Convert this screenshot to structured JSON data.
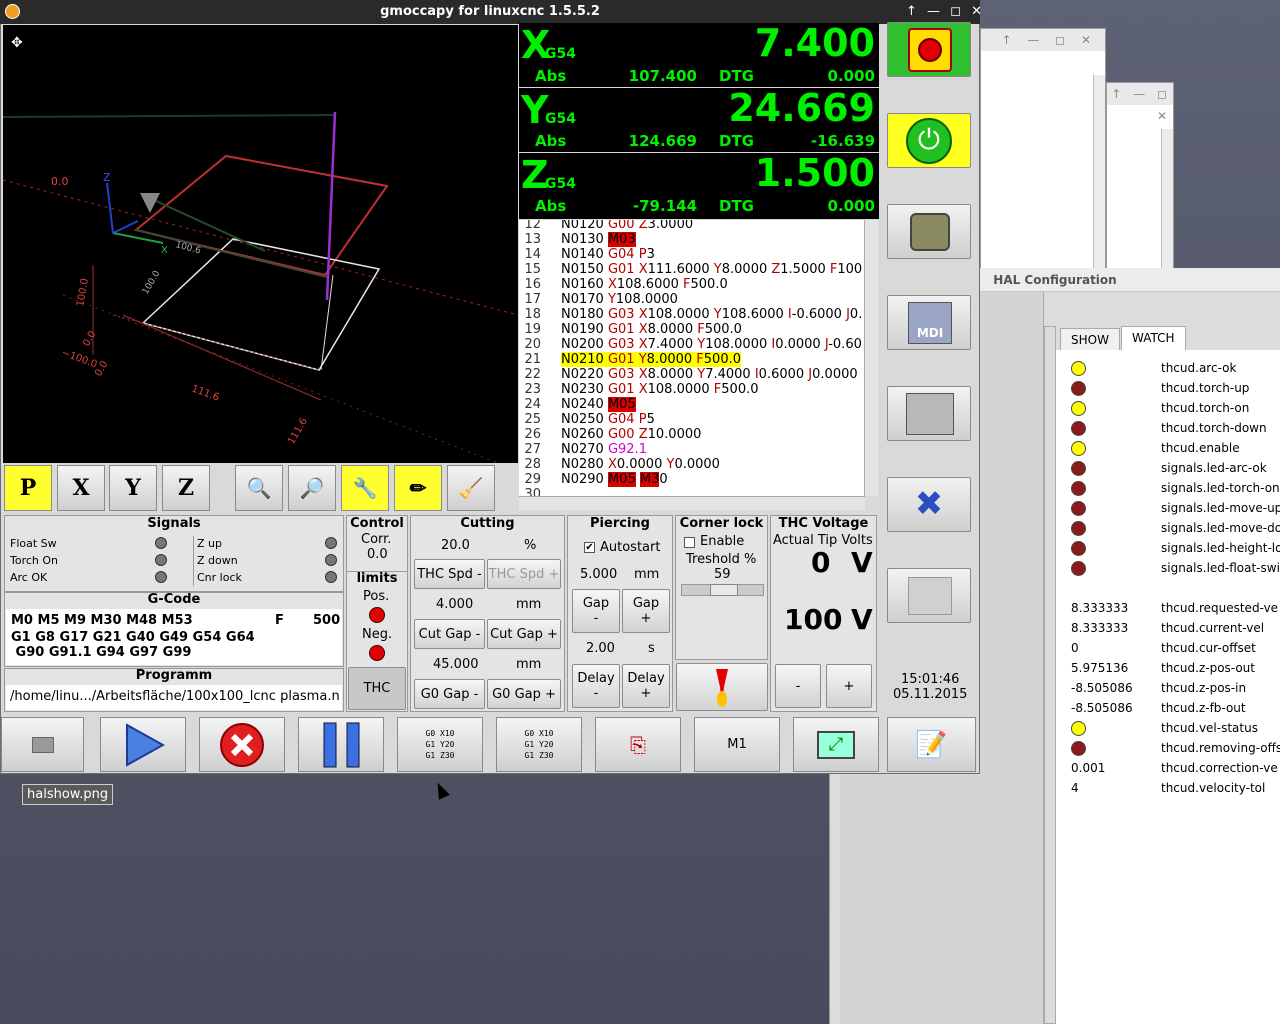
{
  "window": {
    "title": "gmoccapy for linuxcnc  1.5.5.2",
    "controls": "↑ — ◻ ✕"
  },
  "bg_window": {
    "controls": "↑ — ◻ ✕"
  },
  "hal": {
    "title": "HAL Configuration",
    "tabs": [
      "SHOW",
      "WATCH"
    ],
    "rows": [
      {
        "state": "y",
        "name": "thcud.arc-ok"
      },
      {
        "state": "r",
        "name": "thcud.torch-up"
      },
      {
        "state": "y",
        "name": "thcud.torch-on"
      },
      {
        "state": "r",
        "name": "thcud.torch-down"
      },
      {
        "state": "y",
        "name": "thcud.enable"
      },
      {
        "state": "r",
        "name": "signals.led-arc-ok"
      },
      {
        "state": "r",
        "name": "signals.led-torch-on"
      },
      {
        "state": "r",
        "name": "signals.led-move-up"
      },
      {
        "state": "r",
        "name": "signals.led-move-do"
      },
      {
        "state": "r",
        "name": "signals.led-height-lo"
      },
      {
        "state": "r",
        "name": "signals.led-float-swit"
      },
      {
        "state": "",
        "name": ""
      },
      {
        "value": "8.333333",
        "name": "thcud.requested-ve"
      },
      {
        "value": "8.333333",
        "name": "thcud.current-vel"
      },
      {
        "value": "0",
        "name": "thcud.cur-offset"
      },
      {
        "value": "5.975136",
        "name": "thcud.z-pos-out"
      },
      {
        "value": "-8.505086",
        "name": "thcud.z-pos-in"
      },
      {
        "value": "-8.505086",
        "name": "thcud.z-fb-out"
      },
      {
        "state": "y",
        "name": "thcud.vel-status"
      },
      {
        "state": "r",
        "name": "thcud.removing-offs"
      },
      {
        "value": "0.001",
        "name": "thcud.correction-ve"
      },
      {
        "value": "4",
        "name": "thcud.velocity-tol"
      }
    ]
  },
  "preview": {
    "labels": {
      "z": "Z",
      "x": "X",
      "zero": "0.0",
      "v100": "100.0",
      "neg100": "−100.0",
      "v1116a": "111.6",
      "v1116b": "111.6",
      "v00a": "0.0",
      "v00b": "0.0",
      "v100b": "100.0",
      "v1006": "100.6"
    }
  },
  "dro": [
    {
      "axis": "X",
      "coord": "G54",
      "value": "7.400",
      "abs_label": "Abs",
      "abs": "107.400",
      "dtg_label": "DTG",
      "dtg": "0.000"
    },
    {
      "axis": "Y",
      "coord": "G54",
      "value": "24.669",
      "abs_label": "Abs",
      "abs": "124.669",
      "dtg_label": "DTG",
      "dtg": "-16.639"
    },
    {
      "axis": "Z",
      "coord": "G54",
      "value": "1.500",
      "abs_label": "Abs",
      "abs": "-79.144",
      "dtg_label": "DTG",
      "dtg": "0.000"
    }
  ],
  "gcode_lines": [
    {
      "n": "12",
      "html": "N0120 <span class='kw'>G00</span> <span class='kw'>Z</span>3.0000"
    },
    {
      "n": "13",
      "html": "N0130 <span class='redb'>M03</span>"
    },
    {
      "n": "14",
      "html": "N0140 <span class='kw'>G04</span> <span class='kw'>P</span>3"
    },
    {
      "n": "15",
      "html": "N0150 <span class='kw'>G01</span> <span class='kw'>X</span>111.6000 <span class='kw'>Y</span>8.0000 <span class='kw'>Z</span>1.5000 <span class='kw'>F</span>100"
    },
    {
      "n": "16",
      "html": "N0160 <span class='kw'>X</span>108.6000 <span class='kw'>F</span>500.0"
    },
    {
      "n": "17",
      "html": "N0170 <span class='kw'>Y</span>108.0000"
    },
    {
      "n": "18",
      "html": "N0180 <span class='kw'>G03</span> <span class='kw'>X</span>108.0000 <span class='kw'>Y</span>108.6000 <span class='kw'>I</span>-0.6000 <span class='kw'>J</span>0."
    },
    {
      "n": "19",
      "html": "N0190 <span class='kw'>G01</span> <span class='kw'>X</span>8.0000 <span class='kw'>F</span>500.0"
    },
    {
      "n": "20",
      "html": "N0200 <span class='kw'>G03</span> <span class='kw'>X</span>7.4000 <span class='kw'>Y</span>108.0000 <span class='kw'>I</span>0.0000 <span class='kw'>J</span>-0.60"
    },
    {
      "n": "21",
      "html": "N0210 <span class='kw'>G01</span> <span class='kw'>Y</span>8.0000 <span class='kw'>F</span>500.0",
      "hl": true
    },
    {
      "n": "22",
      "html": "N0220 <span class='kw'>G03</span> <span class='kw'>X</span>8.0000 <span class='kw'>Y</span>7.4000 <span class='kw'>I</span>0.6000 <span class='kw'>J</span>0.0000"
    },
    {
      "n": "23",
      "html": "N0230 <span class='kw'>G01</span> <span class='kw'>X</span>108.0000 <span class='kw'>F</span>500.0"
    },
    {
      "n": "24",
      "html": "N0240 <span class='redb'>M05</span>"
    },
    {
      "n": "25",
      "html": "N0250 <span class='kw'>G04</span> <span class='kw'>P</span>5"
    },
    {
      "n": "26",
      "html": "N0260 <span class='kw'>G00</span> <span class='kw'>Z</span>10.0000"
    },
    {
      "n": "27",
      "html": "N0270 <span class='mag'>G92.1</span>"
    },
    {
      "n": "28",
      "html": "N0280 <span class='kw'>X</span>0.0000 <span class='kw'>Y</span>0.0000"
    },
    {
      "n": "29",
      "html": "N0290 <span class='redb'>M05</span> <span class='redb'>M3</span>0"
    },
    {
      "n": "30",
      "html": ""
    }
  ],
  "signals": {
    "title": "Signals",
    "left": [
      "Float Sw",
      "Torch On",
      "Arc OK"
    ],
    "right": [
      "Z up",
      "Z down",
      "Cnr lock"
    ]
  },
  "gcode": {
    "title": "G-Code",
    "line1": "M0 M5 M9 M30 M48 M53",
    "f_label": "F",
    "f_value": "500",
    "line2": "G1 G8 G17 G21 G40 G49 G54 G64",
    "line3": " G90 G91.1 G94 G97 G99"
  },
  "programm": {
    "title": "Programm",
    "path": "/home/linu.../Arbeitsfläche/100x100_lcnc plasma.n"
  },
  "control": {
    "title": "Control",
    "corr_label": "Corr.",
    "corr": "0.0",
    "limits": "limits",
    "pos": "Pos.",
    "neg": "Neg.",
    "thc": "THC"
  },
  "cutting": {
    "title": "Cutting",
    "v1": "20.0",
    "u1": "%",
    "b1": "THC Spd -",
    "b2": "THC Spd +",
    "v2": "4.000",
    "u2": "mm",
    "b3": "Cut Gap -",
    "b4": "Cut Gap +",
    "v3": "45.000",
    "u3": "mm",
    "b5": "G0 Gap -",
    "b6": "G0 Gap +"
  },
  "piercing": {
    "title": "Piercing",
    "autostart": "Autostart",
    "v1": "5.000",
    "u1": "mm",
    "gap_minus": "Gap\n-",
    "gap_plus": "Gap\n+",
    "v2": "2.00",
    "u2": "s",
    "delay_minus": "Delay\n-",
    "delay_plus": "Delay\n+"
  },
  "corner": {
    "title": "Corner lock",
    "enable": "Enable",
    "treshold": "Treshold %",
    "value": "59"
  },
  "thcv": {
    "title": "THC Voltage",
    "actual": "Actual Tip Volts",
    "v1": "0",
    "unit1": "V",
    "v2": "100",
    "unit2": "V",
    "minus": "-",
    "plus": "+"
  },
  "clock": {
    "time": "15:01:46",
    "date": "05.11.2015"
  },
  "bottom": {
    "m1": "M1",
    "g1": "G0 X10\nG1 Y20\nG1 Z30",
    "g2": "G0 X10\nG1 Y20\nG1 Z30"
  },
  "tooltip": "halshow.png"
}
